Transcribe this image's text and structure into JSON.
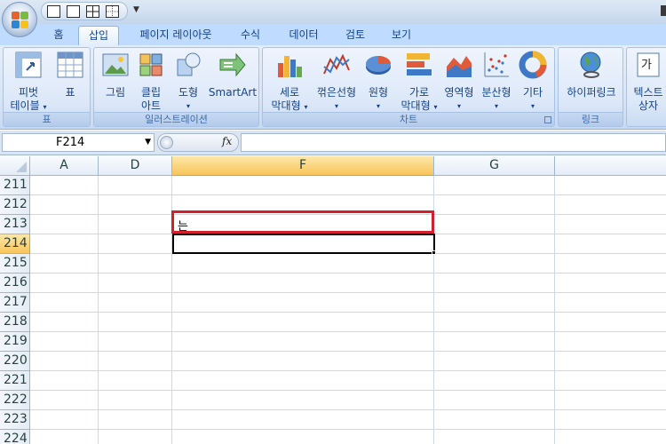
{
  "tabs": [
    "홈",
    "삽입",
    "페이지 레이아웃",
    "수식",
    "데이터",
    "검토",
    "보기"
  ],
  "active_tab": "삽입",
  "ribbon": {
    "table_group": {
      "label": "표",
      "pivot_line1": "피벗",
      "pivot_line2": "테이블",
      "table": "표"
    },
    "illustrations_group": {
      "label": "일러스트레이션",
      "picture": "그림",
      "clipart_line1": "클립",
      "clipart_line2": "아트",
      "shapes": "도형",
      "smartart": "SmartArt"
    },
    "charts_group": {
      "label": "차트",
      "column_line1": "세로",
      "column_line2": "막대형",
      "line": "꺾은선형",
      "pie": "원형",
      "bar_line1": "가로",
      "bar_line2": "막대형",
      "area": "영역형",
      "scatter": "분산형",
      "other": "기타"
    },
    "links_group": {
      "label": "링크",
      "hyperlink": "하이퍼링크"
    },
    "text_group": {
      "textbox_line1": "텍스트",
      "textbox_line2": "상자"
    }
  },
  "formula_bar": {
    "name_box": "F214",
    "fx": "fx",
    "formula": ""
  },
  "columns": [
    "A",
    "D",
    "F",
    "G"
  ],
  "selected_column": "F",
  "rows": [
    "211",
    "212",
    "213",
    "214",
    "215",
    "216",
    "217",
    "218",
    "219",
    "220",
    "221",
    "222",
    "223",
    "224"
  ],
  "selected_row": "214",
  "cells": {
    "F213": "는"
  },
  "colors": {
    "highlight_box": "#d4202b",
    "selected_header": "#f8c55b",
    "ribbon_bg": "#dbe8f9",
    "tab_text": "#15428b"
  },
  "icons": {
    "office_button": "office-logo-icon",
    "pivot": "pivot-table-icon",
    "table": "table-icon",
    "picture": "picture-icon",
    "clipart": "clip-art-icon",
    "shapes": "shapes-icon",
    "smartart": "smartart-icon",
    "column_chart": "column-chart-icon",
    "line_chart": "line-chart-icon",
    "pie_chart": "pie-chart-icon",
    "bar_chart": "bar-chart-icon",
    "area_chart": "area-chart-icon",
    "scatter_chart": "scatter-chart-icon",
    "other_chart": "doughnut-chart-icon",
    "hyperlink": "globe-link-icon",
    "textbox": "textbox-icon"
  }
}
